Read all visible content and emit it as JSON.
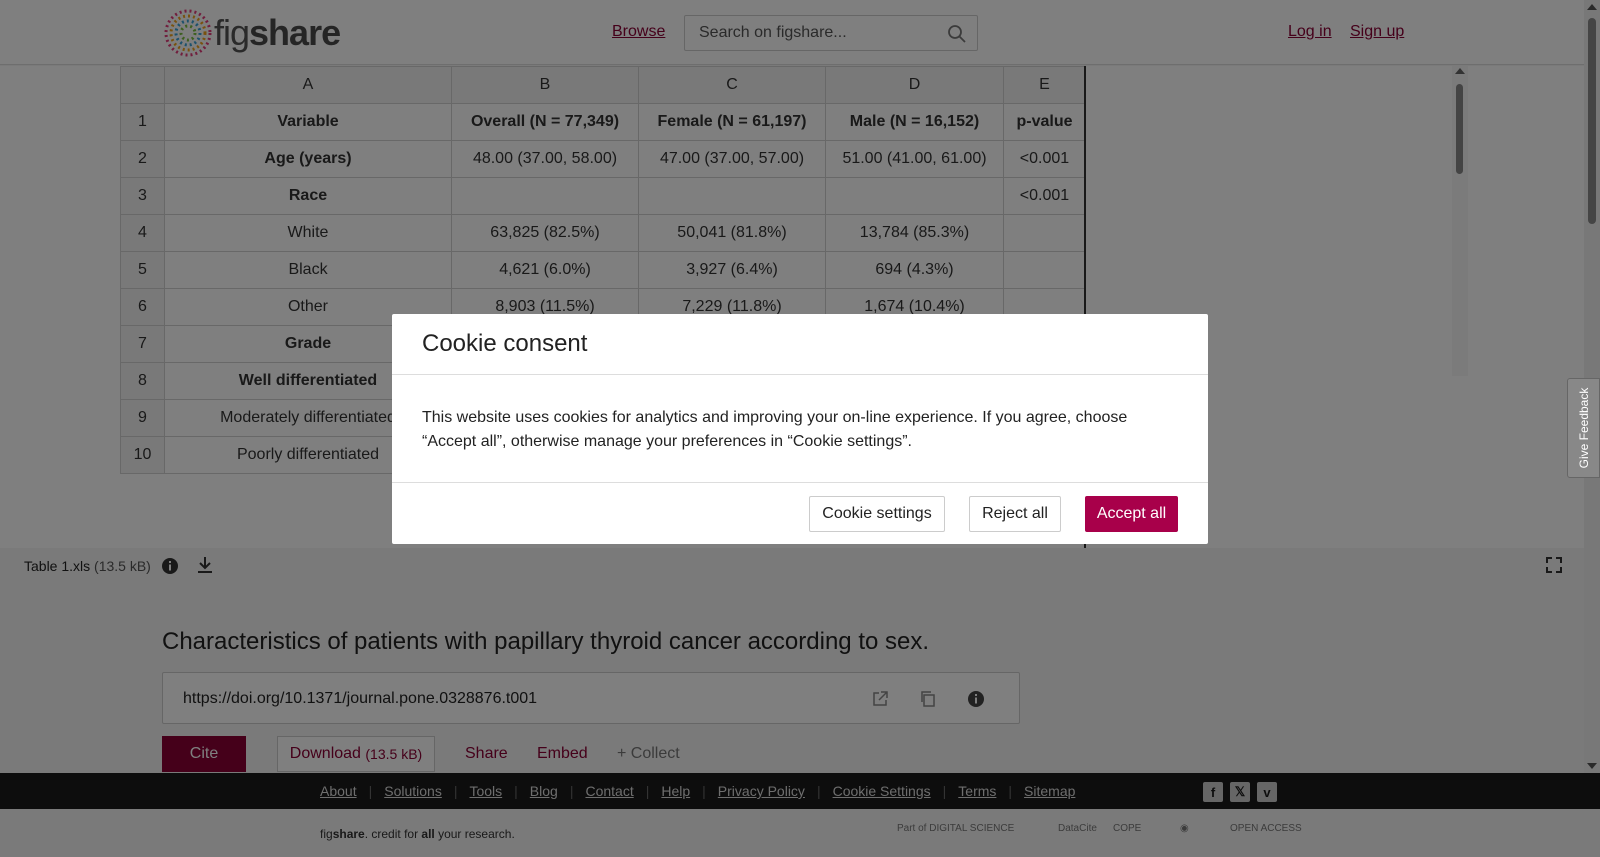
{
  "header": {
    "logo_text_light": "fig",
    "logo_text_bold": "share",
    "browse": "Browse",
    "search_placeholder": "Search on figshare...",
    "login": "Log in",
    "signup": "Sign up"
  },
  "sheet": {
    "columns": [
      "A",
      "B",
      "C",
      "D",
      "E"
    ],
    "rows": [
      {
        "n": "1",
        "cells": [
          "Variable",
          "Overall (N = 77,349)",
          "Female (N = 61,197)",
          "Male (N = 16,152)",
          "p-value"
        ],
        "bold": true
      },
      {
        "n": "2",
        "cells": [
          "Age (years)",
          "48.00 (37.00, 58.00)",
          "47.00 (37.00, 57.00)",
          "51.00 (41.00, 61.00)",
          "<0.001"
        ],
        "bold_first": true
      },
      {
        "n": "3",
        "cells": [
          "Race",
          "",
          "",
          "",
          "<0.001"
        ],
        "bold_first": true
      },
      {
        "n": "4",
        "cells": [
          "White",
          "63,825 (82.5%)",
          "50,041 (81.8%)",
          "13,784 (85.3%)",
          ""
        ]
      },
      {
        "n": "5",
        "cells": [
          "Black",
          "4,621 (6.0%)",
          "3,927 (6.4%)",
          "694 (4.3%)",
          ""
        ]
      },
      {
        "n": "6",
        "cells": [
          "Other",
          "8,903 (11.5%)",
          "7,229 (11.8%)",
          "1,674 (10.4%)",
          ""
        ]
      },
      {
        "n": "7",
        "cells": [
          "Grade",
          "",
          "",
          "",
          ""
        ],
        "bold_first": true
      },
      {
        "n": "8",
        "cells": [
          "Well differentiated",
          "",
          "",
          "",
          ""
        ],
        "bold_first": true
      },
      {
        "n": "9",
        "cells": [
          "Moderately differentiated",
          "",
          "",
          "",
          ""
        ]
      },
      {
        "n": "10",
        "cells": [
          "Poorly differentiated",
          "",
          "",
          "",
          ""
        ]
      }
    ]
  },
  "file": {
    "name": "Table 1.xls",
    "size": "(13.5 kB)"
  },
  "item": {
    "title": "Characteristics of patients with papillary thyroid cancer according to sex.",
    "doi": "https://doi.org/10.1371/journal.pone.0328876.t001",
    "cite": "Cite",
    "download": "Download",
    "download_size": "(13.5 kB)",
    "share": "Share",
    "embed": "Embed",
    "collect": "+ Collect"
  },
  "footer": {
    "links": [
      "About",
      "Solutions",
      "Tools",
      "Blog",
      "Contact",
      "Help",
      "Privacy Policy",
      "Cookie Settings",
      "Terms",
      "Sitemap"
    ],
    "tagline_a": "fig",
    "tagline_b": "share",
    "tagline_c": ". credit for ",
    "tagline_d": "all",
    "tagline_e": " your research.",
    "partner_ds": "Part of DIGITAL SCIENCE",
    "partner_datacite": "DataCite",
    "partner_cope": "COPE",
    "partner_oa": "OPEN ACCESS"
  },
  "cookie": {
    "title": "Cookie consent",
    "body": "This website uses cookies for analytics and improving your on-line experience. If you agree, choose “Accept all”, otherwise manage your preferences in “Cookie settings”.",
    "settings": "Cookie settings",
    "reject": "Reject all",
    "accept": "Accept all"
  },
  "feedback": "Give Feedback",
  "colors": {
    "brand": "#8b0035",
    "accept": "#a8004a"
  }
}
